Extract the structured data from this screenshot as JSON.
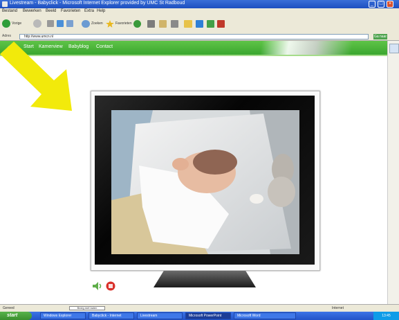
{
  "window": {
    "title": "Livestream - Babyclick - Microsoft Internet Explorer provided by UMC St Radboud"
  },
  "menu": [
    "Bestand",
    "Bewerken",
    "Beeld",
    "Favorieten",
    "Extra",
    "Help"
  ],
  "toolbar": {
    "back_label": "Vorige",
    "search_label": "Zoeken",
    "favorites_label": "Favorieten"
  },
  "address": {
    "label": "Adres",
    "url": "http://www.umcn.nl",
    "go_label": "Ga naar"
  },
  "site_nav": {
    "home_icon": "home-icon",
    "links": [
      "Start",
      "Kamerview",
      "Babyblog",
      "Contact"
    ]
  },
  "player": {
    "speaker_icon": "speaker-icon",
    "stop_icon": "stop-icon"
  },
  "status": {
    "left_text": "Gereed",
    "progress_text": "Bezig met laden",
    "zone": "Internet"
  },
  "taskbar": {
    "start_label": "start",
    "tasks": [
      "Windows Explorer",
      "Babyclick - Internet",
      "Livestream",
      "Microsoft PowerPoint",
      "Microsoft Word"
    ],
    "clock": "13:45"
  },
  "colors": {
    "nav_green": "#3aa62f",
    "arrow_yellow": "#f2ea0b",
    "xp_blue": "#2353c8"
  }
}
